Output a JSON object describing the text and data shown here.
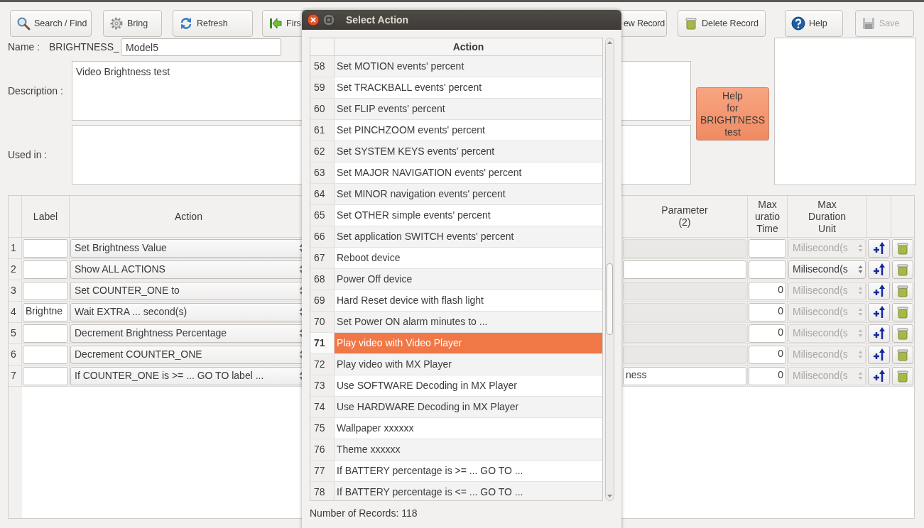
{
  "toolbar_left": [
    {
      "label": "Search / Find",
      "kind": "search",
      "disabled": false
    },
    {
      "label": "Bring",
      "kind": "gear",
      "disabled": false
    },
    {
      "label": "Refresh",
      "kind": "refresh",
      "disabled": false
    },
    {
      "label": "Firs",
      "kind": "first",
      "disabled": false
    }
  ],
  "toolbar_right": [
    {
      "label": "ew Record",
      "disabled": false
    },
    {
      "label": "Delete Record",
      "kind": "trash",
      "disabled": false
    },
    {
      "label": "Help",
      "kind": "help",
      "disabled": false
    },
    {
      "label": "Save",
      "kind": "save",
      "disabled": true
    }
  ],
  "form": {
    "name_label": "Name :",
    "name_prefix": "BRIGHTNESS_",
    "name_value": "Model5",
    "description_label": "Description :",
    "description_value": "Video Brightness test",
    "used_in_label": "Used in :",
    "help_button": "Help\nfor\nBRIGHTNESS\ntest"
  },
  "table": {
    "columns": [
      "Label",
      "Action",
      "Parameter\n(2)",
      "Max\nuratio\nTime",
      "Max\nDuration\nUnit"
    ],
    "rows": [
      {
        "number": "1",
        "action": "Set Brightness Value",
        "parameter_enabled": false,
        "unit": "Milisecond(s",
        "unit_enabled": false
      },
      {
        "number": "2",
        "action": "Show ALL ACTIONS",
        "parameter_enabled": true,
        "unit": "Milisecond(s",
        "unit_enabled": true
      },
      {
        "number": "3",
        "action": "Set COUNTER_ONE to",
        "parameter_enabled": false,
        "duration": "0",
        "unit": "Milisecond(s",
        "unit_enabled": false
      },
      {
        "number": "4",
        "label": "Brightne",
        "action": "Wait EXTRA ... second(s)",
        "parameter_enabled": false,
        "duration": "0",
        "unit": "Milisecond(s",
        "unit_enabled": false
      },
      {
        "number": "5",
        "action": "Decrement Brightness Percentage",
        "parameter_enabled": false,
        "duration": "0",
        "unit": "Milisecond(s",
        "unit_enabled": false
      },
      {
        "number": "6",
        "action": "Decrement COUNTER_ONE",
        "parameter_enabled": false,
        "duration": "0",
        "unit": "Milisecond(s",
        "unit_enabled": false
      },
      {
        "number": "7",
        "action": "If COUNTER_ONE is >= ... GO TO label ...",
        "parameter": "ness",
        "parameter_enabled": true,
        "duration": "0",
        "unit": "Milisecond(s",
        "unit_enabled": false
      }
    ]
  },
  "dialog": {
    "title": "Select Action",
    "column": "Action",
    "rows": [
      {
        "number": "58",
        "text": "Set MOTION events' percent",
        "selected": false
      },
      {
        "number": "59",
        "text": "Set TRACKBALL  events' percent",
        "selected": false
      },
      {
        "number": "60",
        "text": "Set FLIP events' percent",
        "selected": false
      },
      {
        "number": "61",
        "text": "Set PINCHZOOM  events' percent",
        "selected": false
      },
      {
        "number": "62",
        "text": "Set SYSTEM KEYS events' percent",
        "selected": false
      },
      {
        "number": "63",
        "text": "Set MAJOR NAVIGATION events' percent",
        "selected": false
      },
      {
        "number": "64",
        "text": "Set MINOR navigation events' percent",
        "selected": false
      },
      {
        "number": "65",
        "text": "Set OTHER simple events' percent",
        "selected": false
      },
      {
        "number": "66",
        "text": "Set application SWITCH events' percent",
        "selected": false
      },
      {
        "number": "67",
        "text": "Reboot device",
        "selected": false
      },
      {
        "number": "68",
        "text": "Power Off device",
        "selected": false
      },
      {
        "number": "69",
        "text": "Hard Reset device with flash light",
        "selected": false
      },
      {
        "number": "70",
        "text": "Set Power ON alarm minutes to ...",
        "selected": false
      },
      {
        "number": "71",
        "text": "Play video with Video Player",
        "selected": true
      },
      {
        "number": "72",
        "text": "Play video with MX Player",
        "selected": false
      },
      {
        "number": "73",
        "text": "Use SOFTWARE Decoding in MX Player",
        "selected": false
      },
      {
        "number": "74",
        "text": "Use HARDWARE Decoding in MX Player",
        "selected": false
      },
      {
        "number": "75",
        "text": "Wallpaper xxxxxx",
        "selected": false
      },
      {
        "number": "76",
        "text": "Theme xxxxxx",
        "selected": false
      },
      {
        "number": "77",
        "text": "If BATTERY percentage is >= ... GO TO ...",
        "selected": false
      },
      {
        "number": "78",
        "text": "If BATTERY percentage is <= ... GO TO ...",
        "selected": false
      }
    ],
    "footer": "Number of Records: 118"
  }
}
